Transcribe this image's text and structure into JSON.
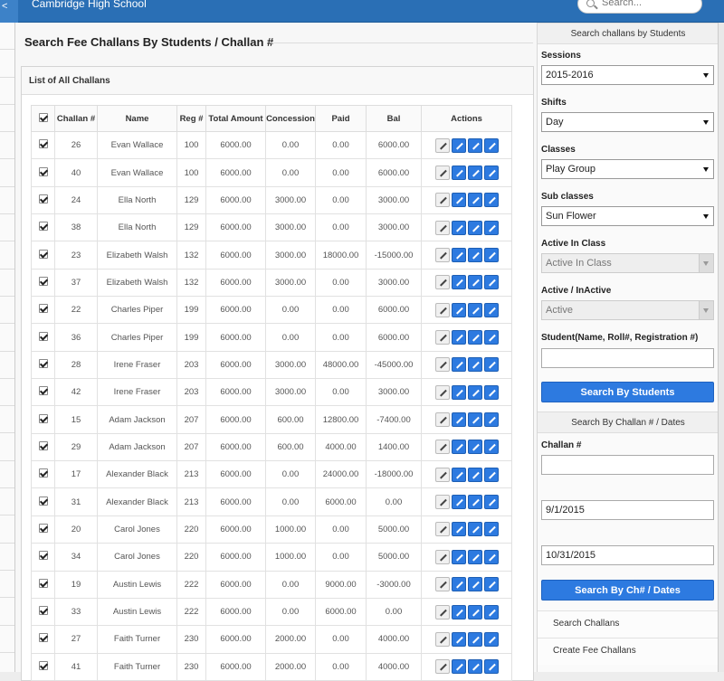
{
  "header": {
    "brand": "Cambridge High School",
    "search_placeholder": "Search..."
  },
  "page": {
    "title": "Search Fee Challans By Students / Challan #"
  },
  "panel": {
    "title": "List of All Challans"
  },
  "table": {
    "columns": [
      "Challan #",
      "Name",
      "Reg #",
      "Total Amount",
      "Concession",
      "Paid",
      "Bal",
      "Actions"
    ],
    "rows": [
      {
        "challan": "26",
        "name": "Evan Wallace",
        "reg": "100",
        "total": "6000.00",
        "concession": "0.00",
        "paid": "0.00",
        "bal": "6000.00"
      },
      {
        "challan": "40",
        "name": "Evan Wallace",
        "reg": "100",
        "total": "6000.00",
        "concession": "0.00",
        "paid": "0.00",
        "bal": "6000.00"
      },
      {
        "challan": "24",
        "name": "Ella North",
        "reg": "129",
        "total": "6000.00",
        "concession": "3000.00",
        "paid": "0.00",
        "bal": "3000.00"
      },
      {
        "challan": "38",
        "name": "Ella North",
        "reg": "129",
        "total": "6000.00",
        "concession": "3000.00",
        "paid": "0.00",
        "bal": "3000.00"
      },
      {
        "challan": "23",
        "name": "Elizabeth Walsh",
        "reg": "132",
        "total": "6000.00",
        "concession": "3000.00",
        "paid": "18000.00",
        "bal": "-15000.00"
      },
      {
        "challan": "37",
        "name": "Elizabeth Walsh",
        "reg": "132",
        "total": "6000.00",
        "concession": "3000.00",
        "paid": "0.00",
        "bal": "3000.00"
      },
      {
        "challan": "22",
        "name": "Charles Piper",
        "reg": "199",
        "total": "6000.00",
        "concession": "0.00",
        "paid": "0.00",
        "bal": "6000.00"
      },
      {
        "challan": "36",
        "name": "Charles Piper",
        "reg": "199",
        "total": "6000.00",
        "concession": "0.00",
        "paid": "0.00",
        "bal": "6000.00"
      },
      {
        "challan": "28",
        "name": "Irene Fraser",
        "reg": "203",
        "total": "6000.00",
        "concession": "3000.00",
        "paid": "48000.00",
        "bal": "-45000.00"
      },
      {
        "challan": "42",
        "name": "Irene Fraser",
        "reg": "203",
        "total": "6000.00",
        "concession": "3000.00",
        "paid": "0.00",
        "bal": "3000.00"
      },
      {
        "challan": "15",
        "name": "Adam Jackson",
        "reg": "207",
        "total": "6000.00",
        "concession": "600.00",
        "paid": "12800.00",
        "bal": "-7400.00"
      },
      {
        "challan": "29",
        "name": "Adam Jackson",
        "reg": "207",
        "total": "6000.00",
        "concession": "600.00",
        "paid": "4000.00",
        "bal": "1400.00"
      },
      {
        "challan": "17",
        "name": "Alexander Black",
        "reg": "213",
        "total": "6000.00",
        "concession": "0.00",
        "paid": "24000.00",
        "bal": "-18000.00"
      },
      {
        "challan": "31",
        "name": "Alexander Black",
        "reg": "213",
        "total": "6000.00",
        "concession": "0.00",
        "paid": "6000.00",
        "bal": "0.00"
      },
      {
        "challan": "20",
        "name": "Carol Jones",
        "reg": "220",
        "total": "6000.00",
        "concession": "1000.00",
        "paid": "0.00",
        "bal": "5000.00"
      },
      {
        "challan": "34",
        "name": "Carol Jones",
        "reg": "220",
        "total": "6000.00",
        "concession": "1000.00",
        "paid": "0.00",
        "bal": "5000.00"
      },
      {
        "challan": "19",
        "name": "Austin Lewis",
        "reg": "222",
        "total": "6000.00",
        "concession": "0.00",
        "paid": "9000.00",
        "bal": "-3000.00"
      },
      {
        "challan": "33",
        "name": "Austin Lewis",
        "reg": "222",
        "total": "6000.00",
        "concession": "0.00",
        "paid": "6000.00",
        "bal": "0.00"
      },
      {
        "challan": "27",
        "name": "Faith Turner",
        "reg": "230",
        "total": "6000.00",
        "concession": "2000.00",
        "paid": "0.00",
        "bal": "4000.00"
      },
      {
        "challan": "41",
        "name": "Faith Turner",
        "reg": "230",
        "total": "6000.00",
        "concession": "2000.00",
        "paid": "0.00",
        "bal": "4000.00"
      }
    ]
  },
  "sidebar": {
    "students_header": "Search challans by Students",
    "sessions_label": "Sessions",
    "sessions_value": "2015-2016",
    "shifts_label": "Shifts",
    "shifts_value": "Day",
    "classes_label": "Classes",
    "classes_value": "Play Group",
    "subclasses_label": "Sub classes",
    "subclasses_value": "Sun Flower",
    "active_in_class_label": "Active In Class",
    "active_in_class_value": "Active In Class",
    "active_inactive_label": "Active / InActive",
    "active_inactive_value": "Active",
    "student_label": "Student(Name, Roll#, Registration #)",
    "student_value": "",
    "search_students_button": "Search By Students",
    "challan_header": "Search By Challan # / Dates",
    "challan_label": "Challan #",
    "challan_value": "",
    "date_from": "9/1/2015",
    "date_to": "10/31/2015",
    "search_challan_button": "Search By Ch# / Dates",
    "link_search": "Search Challans",
    "link_create": "Create Fee Challans"
  }
}
